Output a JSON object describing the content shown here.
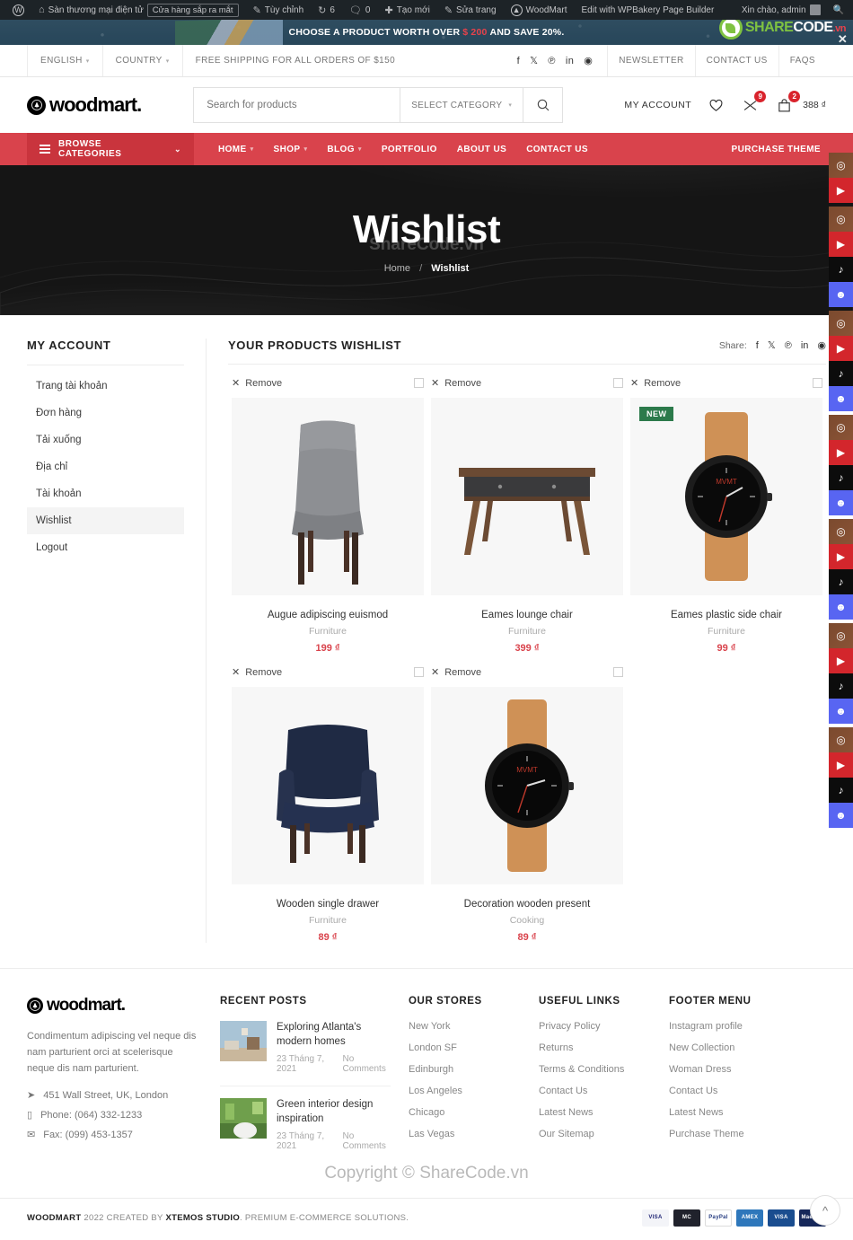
{
  "adminbar": {
    "site_name": "Sàn thương mại điện tử",
    "pill": "Cửa hàng sắp ra mắt",
    "customize": "Tùy chỉnh",
    "updates_count": "6",
    "comments_count": "0",
    "new": "Tạo mới",
    "edit_page": "Sửa trang",
    "theme": "WoodMart",
    "wpbakery": "Edit with WPBakery Page Builder",
    "greeting": "Xin chào, admin"
  },
  "promo": {
    "text_before": "CHOOSE A PRODUCT WORTH OVER",
    "amount": "$ 200",
    "text_after": "AND SAVE 20%.",
    "watermark_share": "SHARE",
    "watermark_code": "CODE",
    "watermark_vn": ".vn"
  },
  "topbar": {
    "language": "ENGLISH",
    "country": "COUNTRY",
    "shipping": "FREE SHIPPING FOR ALL ORDERS OF $150",
    "socials": [
      "facebook-icon",
      "x-twitter-icon",
      "pinterest-icon",
      "linkedin-icon",
      "telegram-icon"
    ],
    "links": [
      "NEWSLETTER",
      "CONTACT US",
      "FAQS"
    ]
  },
  "header": {
    "brand": "woodmart.",
    "search_placeholder": "Search for products",
    "search_value": "",
    "select_category": "SELECT CATEGORY",
    "my_account": "MY ACCOUNT",
    "wishlist_count": "9",
    "cart_count": "2",
    "cart_total": "388 ₫"
  },
  "nav": {
    "browse": "BROWSE CATEGORIES",
    "items": [
      "HOME",
      "SHOP",
      "BLOG",
      "PORTFOLIO",
      "ABOUT US",
      "CONTACT US"
    ],
    "purchase": "PURCHASE THEME"
  },
  "hero": {
    "title": "Wishlist",
    "watermark": "ShareCode.vn",
    "crumb_home": "Home",
    "crumb_sep": "/",
    "crumb_current": "Wishlist"
  },
  "sidebar": {
    "title": "MY ACCOUNT",
    "items": [
      {
        "label": "Trang tài khoản",
        "active": false
      },
      {
        "label": "Đơn hàng",
        "active": false
      },
      {
        "label": "Tải xuống",
        "active": false
      },
      {
        "label": "Địa chỉ",
        "active": false
      },
      {
        "label": "Tài khoản",
        "active": false
      },
      {
        "label": "Wishlist",
        "active": true
      },
      {
        "label": "Logout",
        "active": false
      }
    ]
  },
  "wishlist": {
    "title": "YOUR PRODUCTS WISHLIST",
    "share_label": "Share:",
    "share_icons": [
      "facebook-icon",
      "x-twitter-icon",
      "pinterest-icon",
      "linkedin-icon",
      "telegram-icon"
    ],
    "remove_label": "Remove",
    "products": [
      {
        "name": "Augue adipiscing euismod",
        "category": "Furniture",
        "price": "199 ₫",
        "badge": "",
        "art": "chair-grey"
      },
      {
        "name": "Eames lounge chair",
        "category": "Furniture",
        "price": "399 ₫",
        "badge": "",
        "art": "desk"
      },
      {
        "name": "Eames plastic side chair",
        "category": "Furniture",
        "price": "99 ₫",
        "badge": "NEW",
        "art": "watch-round"
      },
      {
        "name": "Wooden single drawer",
        "category": "Furniture",
        "price": "89 ₫",
        "badge": "",
        "art": "armchair-navy"
      },
      {
        "name": "Decoration wooden present",
        "category": "Cooking",
        "price": "89 ₫",
        "badge": "",
        "art": "watch-tan"
      }
    ]
  },
  "footer": {
    "brand": "woodmart.",
    "description": "Condimentum adipiscing vel neque dis nam parturient orci at scelerisque neque dis nam parturient.",
    "address": "451 Wall Street, UK, London",
    "phone": "Phone: (064) 332-1233",
    "fax": "Fax: (099) 453-1357",
    "recent_posts_title": "RECENT POSTS",
    "posts": [
      {
        "title": "Exploring Atlanta's modern homes",
        "date": "23 Tháng 7, 2021",
        "comments": "No Comments"
      },
      {
        "title": "Green interior design inspiration",
        "date": "23 Tháng 7, 2021",
        "comments": "No Comments"
      }
    ],
    "stores_title": "OUR STORES",
    "stores": [
      "New York",
      "London SF",
      "Edinburgh",
      "Los Angeles",
      "Chicago",
      "Las Vegas"
    ],
    "useful_title": "USEFUL LINKS",
    "useful": [
      "Privacy Policy",
      "Returns",
      "Terms & Conditions",
      "Contact Us",
      "Latest News",
      "Our Sitemap"
    ],
    "menu_title": "FOOTER MENU",
    "menu": [
      "Instagram profile",
      "New Collection",
      "Woman Dress",
      "Contact Us",
      "Latest News",
      "Purchase Theme"
    ],
    "copyright_brand": "WOODMART",
    "copyright_mid": "2022 CREATED BY",
    "copyright_studio": "XTEMOS STUDIO",
    "copyright_end": ". PREMIUM E-COMMERCE SOLUTIONS.",
    "payments": [
      "VISA",
      "MasterCard",
      "PayPal",
      "AMERICAN EXPRESS",
      "VISA Electron",
      "Maestro"
    ]
  },
  "watermark": "Copyright © ShareCode.vn",
  "rail": {
    "groups": [
      [
        "instagram-icon",
        "youtube-icon"
      ],
      [
        "instagram-icon",
        "youtube-icon",
        "tiktok-icon",
        "discord-icon"
      ],
      [
        "instagram-icon",
        "youtube-icon",
        "tiktok-icon",
        "discord-icon"
      ],
      [
        "instagram-icon",
        "youtube-icon",
        "tiktok-icon",
        "discord-icon"
      ],
      [
        "instagram-icon",
        "youtube-icon",
        "tiktok-icon",
        "discord-icon"
      ],
      [
        "instagram-icon",
        "youtube-icon",
        "tiktok-icon",
        "discord-icon"
      ],
      [
        "instagram-icon",
        "youtube-icon",
        "tiktok-icon",
        "discord-icon"
      ]
    ]
  },
  "colors": {
    "accent": "#d9434c",
    "badge": "#d9232c",
    "new": "#2c7a4b",
    "dark": "#151515"
  }
}
